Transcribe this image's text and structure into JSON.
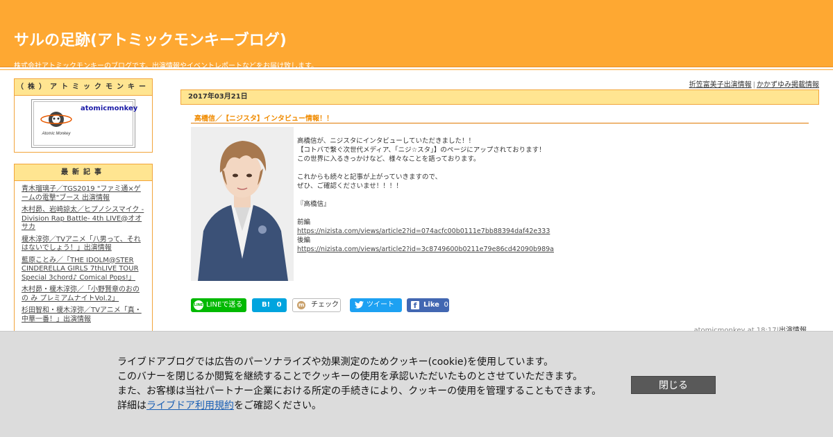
{
  "header": {
    "title": "サルの足跡(アトミックモンキーブログ)",
    "description": "株式会社アトミックモンキーのブログです。出演情報やイベントレポートなどをお届け致します。"
  },
  "sidebar": {
    "profile": {
      "heading": "（株）アトミックモンキー",
      "name": "atomicmonkey",
      "logo_text": "Atomic Monkey"
    },
    "recent": {
      "heading": "最新記事",
      "items": [
        "青木瑠璃子／TGS2019 \"ファミ通×ゲームの電撃\"ブース 出演情報",
        "木村昴、岩崎諒太／ヒプノシスマイク -Division Rap Battle- 4th LIVE@オオサカ",
        "榎木淳弥／TVアニメ「八男って、それはないでしょう！」出演情報",
        "藍原ことみ／「THE IDOLM@STER CINDERELLA GIRLS 7thLIVE TOUR Special 3chord♪ Comical Pops!」",
        "木村昴・榎木淳弥／「小野賢章のおのの み プレミアムナイトVol.2」",
        "杉田智和・榎木淳弥／TVアニメ「真・中華一番！」出演情報"
      ]
    }
  },
  "main": {
    "toplinks": [
      "折笠富美子出演情報",
      "かかずゆみ掲載情報"
    ],
    "date": "2017年03月21日",
    "entry_title": "高橋信／【ニジスタ】インタビュー情報！！",
    "body": {
      "line1": "高橋信が、ニジスタにインタビューしていただきました！！",
      "line2": "【コトバで繋ぐ次世代メディア、「ニジ☆スタ」】のページにアップされております！",
      "line3": "この世界に入るきっかけなど、様々なことを語っております。",
      "line4": "これからも続々と記事が上がっていきますので、",
      "line5": "ぜひ、ご確認くださいませ！！！！",
      "line6": "『高橋信』",
      "part1_label": "前編",
      "part1_url": "https://nizista.com/views/article2?id=074acfc00b0111e7bb88394daf42e333",
      "part2_label": "後編",
      "part2_url": "https://nizista.com/views/article2?id=3c8749600b0211e79e86cd42090b989a"
    },
    "share": {
      "line": "LINEで送る",
      "line_icon": "LINE",
      "hatena_icon": "B!",
      "hatena_count": "0",
      "mixi": "チェック",
      "mixi_icon": "m",
      "tweet": "ツイート",
      "fb_icon": "f",
      "fb_like": "Like",
      "fb_count": "0"
    },
    "footer": {
      "author_time": "atomicmonkey at 18:17",
      "sep": "|",
      "category": "出演情報"
    }
  },
  "cookie": {
    "line1": "ライブドアブログでは広告のパーソナライズや効果測定のためクッキー(cookie)を使用しています。",
    "line2": "このバナーを閉じるか閲覧を継続することでクッキーの使用を承認いただいたものとさせていただきます。",
    "line3": "また、お客様は当社パートナー企業における所定の手続きにより、クッキーの使用を管理することもできます。",
    "line4_prefix": "詳細は",
    "line4_link": "ライブドア利用規約",
    "line4_suffix": "をご確認ください。",
    "close_label": "閉じる"
  }
}
